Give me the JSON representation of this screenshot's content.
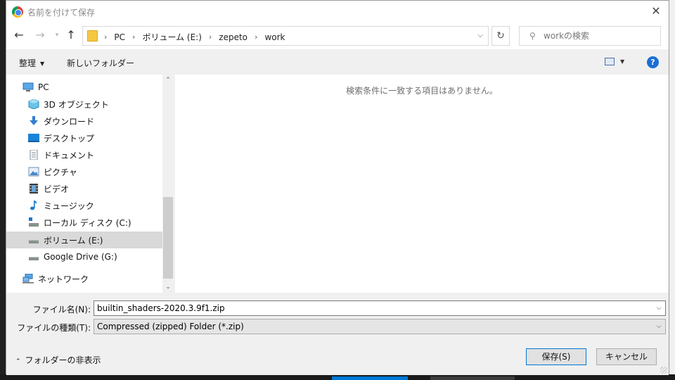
{
  "window": {
    "title": "名前を付けて保存"
  },
  "nav": {
    "breadcrumbs": [
      "PC",
      "ボリューム (E:)",
      "zepeto",
      "work"
    ]
  },
  "search": {
    "placeholder": "workの検索"
  },
  "toolbar": {
    "organize": "整理",
    "new_folder": "新しいフォルダー",
    "help": "?"
  },
  "tree": {
    "items": [
      {
        "label": "PC",
        "icon": "pc-icon"
      },
      {
        "label": "3D オブジェクト",
        "icon": "cube-icon"
      },
      {
        "label": "ダウンロード",
        "icon": "download-icon"
      },
      {
        "label": "デスクトップ",
        "icon": "desktop-icon"
      },
      {
        "label": "ドキュメント",
        "icon": "document-icon"
      },
      {
        "label": "ピクチャ",
        "icon": "picture-icon"
      },
      {
        "label": "ビデオ",
        "icon": "video-icon"
      },
      {
        "label": "ミュージック",
        "icon": "music-icon"
      },
      {
        "label": "ローカル ディスク (C:)",
        "icon": "local-disk-icon"
      },
      {
        "label": "ボリューム (E:)",
        "icon": "drive-icon",
        "selected": true
      },
      {
        "label": "Google Drive (G:)",
        "icon": "drive-icon"
      },
      {
        "label": "ネットワーク",
        "icon": "network-icon"
      }
    ]
  },
  "content": {
    "empty_message": "検索条件に一致する項目はありません。"
  },
  "form": {
    "filename_label": "ファイル名(N):",
    "filename_value": "builtin_shaders-2020.3.9f1.zip",
    "filetype_label": "ファイルの種類(T):",
    "filetype_value": "Compressed (zipped) Folder (*.zip)",
    "hide_folders": "フォルダーの非表示",
    "save": "保存(S)",
    "cancel": "キャンセル"
  },
  "colors": {
    "accent": "#0078d7",
    "selected": "#d9d9d9",
    "help": "#1a6fd6"
  }
}
